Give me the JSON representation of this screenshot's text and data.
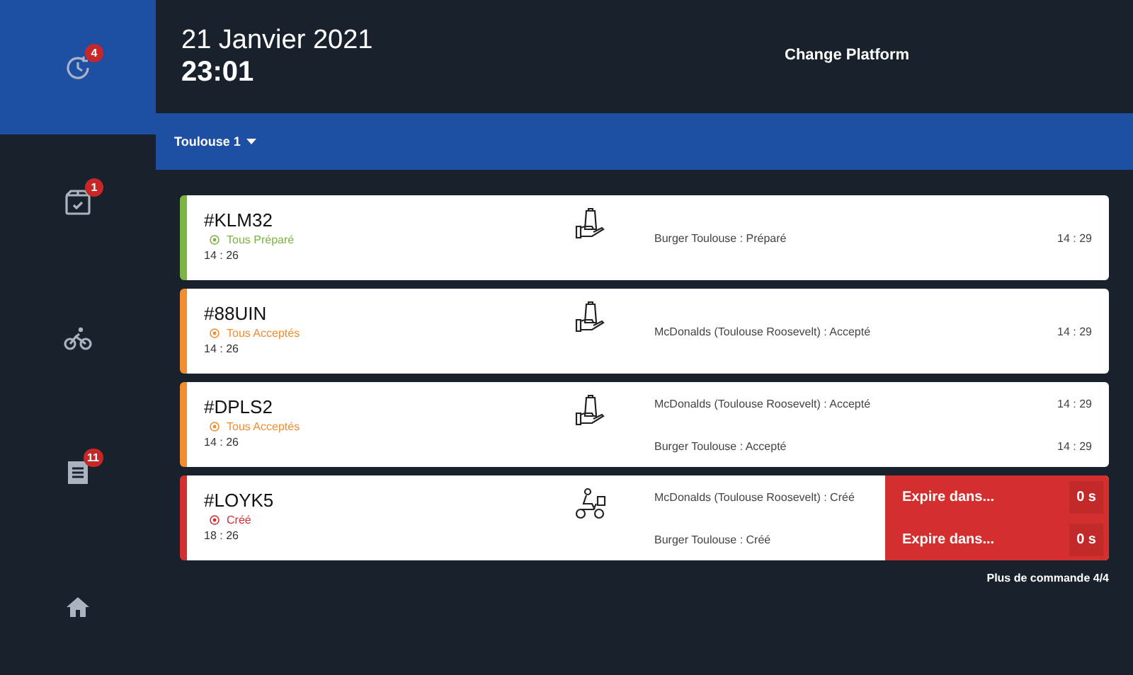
{
  "sidebar": {
    "items": [
      {
        "badge": "4",
        "selected": true
      },
      {
        "badge": "1",
        "selected": false
      },
      {
        "selected": false
      },
      {
        "badge": "11",
        "selected": false
      },
      {
        "selected": false
      }
    ]
  },
  "header": {
    "date": "21 Janvier 2021",
    "time": "23:01",
    "platform_button": "Change Platform"
  },
  "location": {
    "label": "Toulouse 1"
  },
  "orders": [
    {
      "id": "#KLM32",
      "status": "Tous Préparé",
      "color": "#7cb342",
      "time": "14 : 26",
      "kind": "bag",
      "lines": [
        {
          "kind": "time",
          "text": "Burger Toulouse : Préparé",
          "time": "14 : 29"
        }
      ]
    },
    {
      "id": "#88UIN",
      "status": "Tous Acceptés",
      "color": "#f28c30",
      "time": "14 : 26",
      "kind": "bag",
      "lines": [
        {
          "kind": "time",
          "text": "McDonalds (Toulouse Roosevelt) : Accepté",
          "time": "14 : 29"
        }
      ]
    },
    {
      "id": "#DPLS2",
      "status": "Tous Acceptés",
      "color": "#f28c30",
      "time": "14 : 26",
      "kind": "bag",
      "lines": [
        {
          "kind": "time",
          "text": "McDonalds (Toulouse Roosevelt) : Accepté",
          "time": "14 : 29"
        },
        {
          "kind": "time",
          "text": "Burger Toulouse : Accepté",
          "time": "14 : 29"
        }
      ]
    },
    {
      "id": "#LOYK5",
      "status": "Créé",
      "color": "#d32f2f",
      "time": "18 : 26",
      "kind": "scooter",
      "lines": [
        {
          "kind": "expire",
          "text": "McDonalds (Toulouse Roosevelt) : Créé",
          "label": "Expire dans...",
          "countdown": "0 s"
        },
        {
          "kind": "expire",
          "text": "Burger Toulouse : Créé",
          "label": "Expire dans...",
          "countdown": "0 s"
        }
      ]
    }
  ],
  "footer": {
    "more": "Plus de commande 4/4"
  }
}
